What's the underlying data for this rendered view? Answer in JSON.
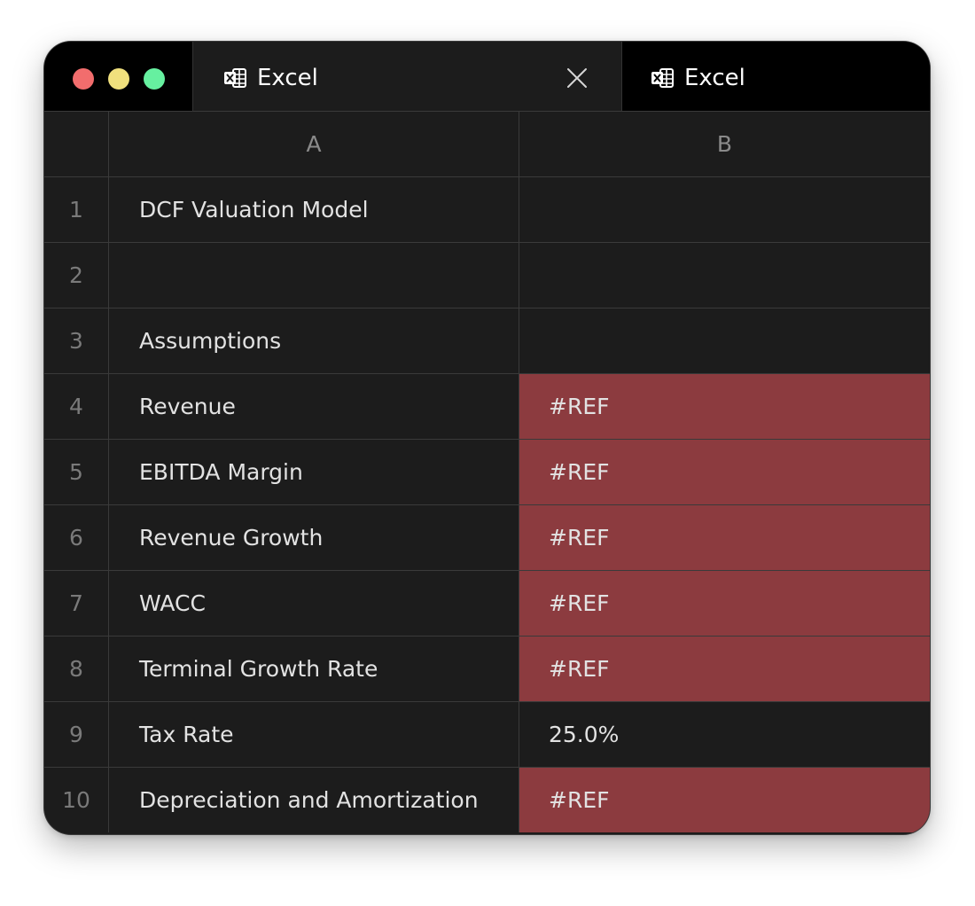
{
  "window": {
    "traffic_lights": [
      {
        "name": "close",
        "color": "#f26d6d"
      },
      {
        "name": "minimize",
        "color": "#f0e07d"
      },
      {
        "name": "maximize",
        "color": "#66f0a0"
      }
    ]
  },
  "tabs": [
    {
      "label": "Excel",
      "icon": "excel-icon",
      "active": true,
      "closable": true
    },
    {
      "label": "Excel",
      "icon": "excel-icon",
      "active": false,
      "closable": false
    }
  ],
  "sheet": {
    "columns": [
      "A",
      "B"
    ],
    "error_fill_color": "#8c3b3f",
    "rows": [
      {
        "num": "1",
        "a": "DCF Valuation Model",
        "b": "",
        "b_error": false
      },
      {
        "num": "2",
        "a": "",
        "b": "",
        "b_error": false
      },
      {
        "num": "3",
        "a": "Assumptions",
        "b": "",
        "b_error": false
      },
      {
        "num": "4",
        "a": "Revenue",
        "b": "#REF",
        "b_error": true
      },
      {
        "num": "5",
        "a": "EBITDA Margin",
        "b": "#REF",
        "b_error": true
      },
      {
        "num": "6",
        "a": "Revenue Growth",
        "b": "#REF",
        "b_error": true
      },
      {
        "num": "7",
        "a": "WACC",
        "b": "#REF",
        "b_error": true
      },
      {
        "num": "8",
        "a": "Terminal Growth Rate",
        "b": "#REF",
        "b_error": true
      },
      {
        "num": "9",
        "a": "Tax Rate",
        "b": "25.0%",
        "b_error": false
      },
      {
        "num": "10",
        "a": "Depreciation and Amortization",
        "b": "#REF",
        "b_error": true
      }
    ]
  }
}
